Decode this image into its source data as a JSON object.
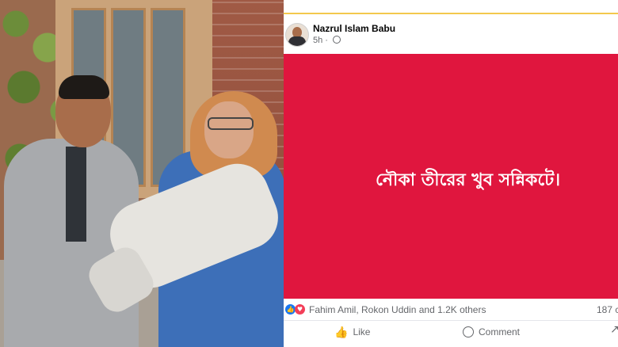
{
  "post": {
    "author": "Nazrul Islam Babu",
    "time": "5h",
    "text": "নৌকা তীরের খুব সন্নিকটে।",
    "reactions": {
      "summary": "Fahim Amil, Rokon Uddin and 1.2K others",
      "comment_count": "187 c"
    },
    "actions": {
      "like": "Like",
      "comment": "Comment"
    }
  },
  "colors": {
    "post_background": "#e0163e",
    "facebook_blue": "#1877f2",
    "love_red": "#f33e58"
  },
  "icons": [
    "globe-icon",
    "like-reaction-icon",
    "love-reaction-icon",
    "like-icon",
    "comment-icon",
    "share-icon"
  ]
}
